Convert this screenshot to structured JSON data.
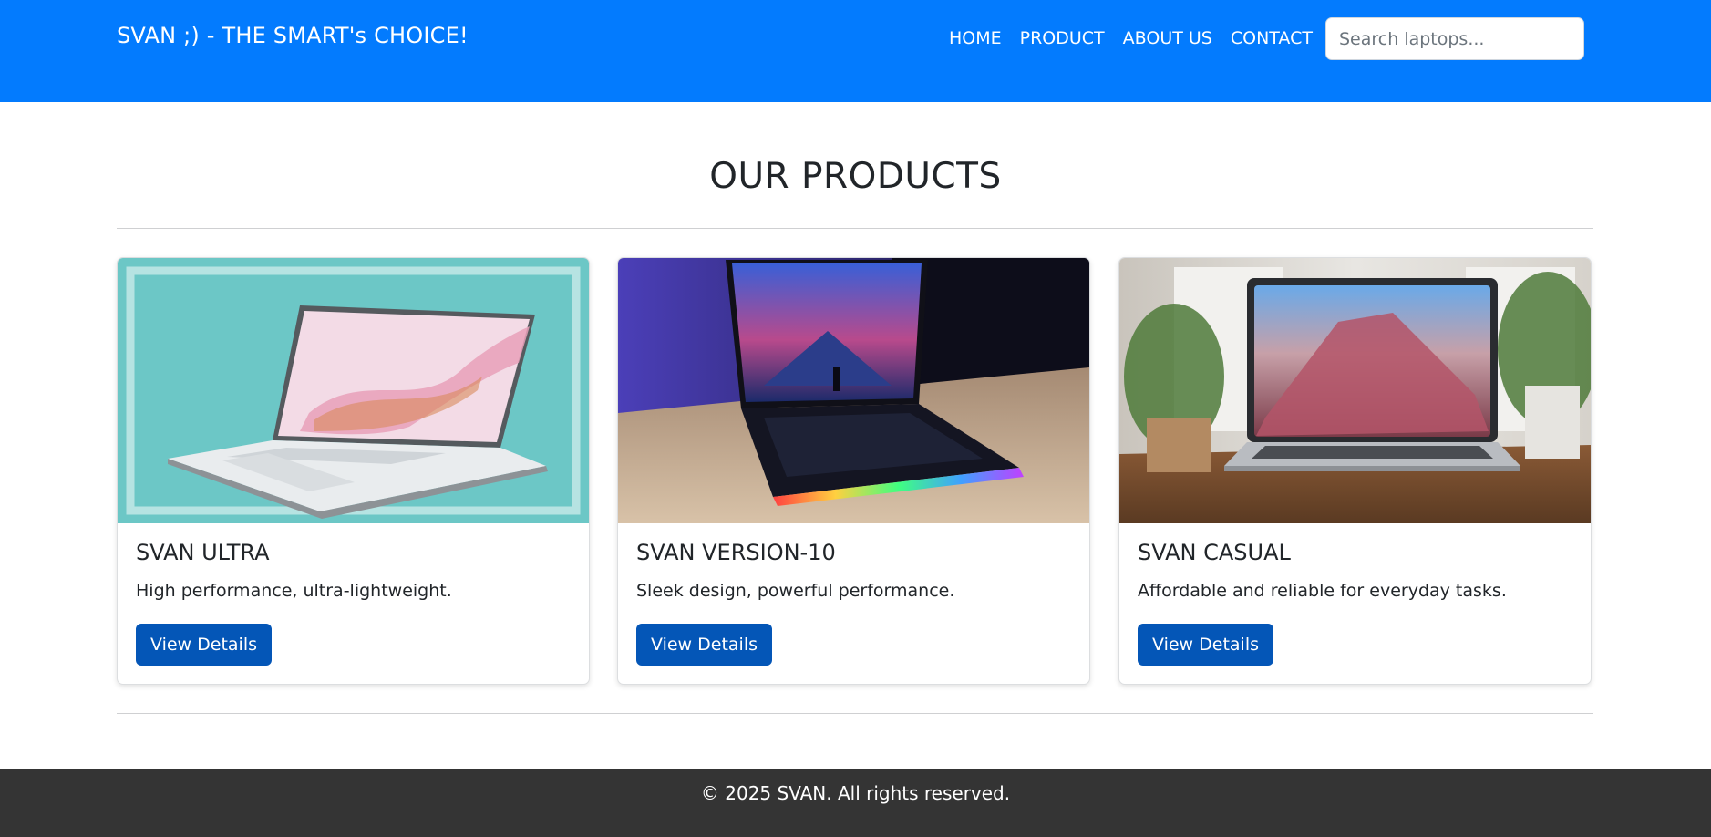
{
  "navbar": {
    "brand": "SVAN ;) - THE SMART's CHOICE!",
    "links": [
      "HOME",
      "PRODUCT",
      "ABOUT US",
      "CONTACT"
    ],
    "search_placeholder": "Search laptops...",
    "background_color": "#037bfe"
  },
  "products_section": {
    "title": "OUR PRODUCTS",
    "cards": [
      {
        "image": "laptop-pink-wallpaper-on-teal",
        "title": "SVAN ULTRA",
        "description": "High performance, ultra-lightweight.",
        "button_label": "View Details"
      },
      {
        "image": "gaming-laptop-rgb-keyboard",
        "title": "SVAN VERSION-10",
        "description": "Sleek design, powerful performance.",
        "button_label": "View Details"
      },
      {
        "image": "laptop-on-wooden-desk-with-plants",
        "title": "SVAN CASUAL",
        "description": "Affordable and reliable for everyday tasks.",
        "button_label": "View Details"
      }
    ],
    "button_color": "#0456b7"
  },
  "footer": {
    "text": "© 2025 SVAN. All rights reserved.",
    "background_color": "#343434"
  }
}
